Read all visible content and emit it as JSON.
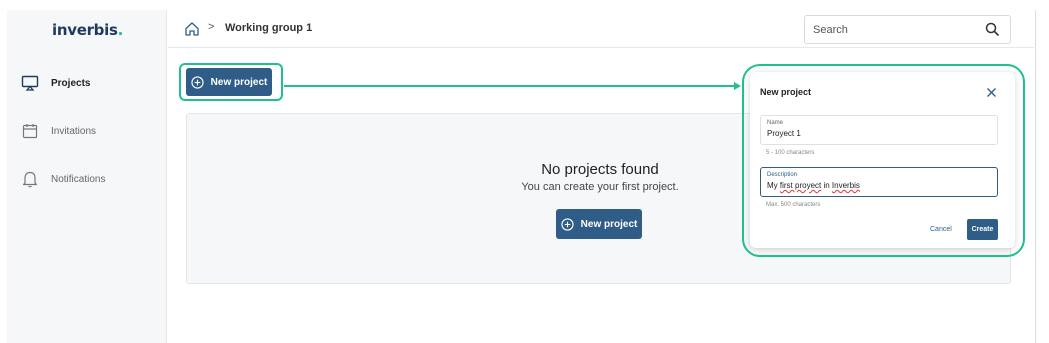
{
  "app": {
    "logo_text": "inverbis",
    "logo_dot": ".",
    "brand_color": "#1f3a5f",
    "accent_color": "#2cb78a"
  },
  "sidebar": {
    "items": [
      {
        "label": "Projects",
        "icon": "monitor-icon",
        "active": true
      },
      {
        "label": "Invitations",
        "icon": "calendar-icon",
        "active": false
      },
      {
        "label": "Notifications",
        "icon": "bell-icon",
        "active": false
      }
    ]
  },
  "header": {
    "breadcrumb_separator": ">",
    "title": "Working group 1",
    "home_icon": "home-icon"
  },
  "search": {
    "placeholder": "Search",
    "icon": "search-icon"
  },
  "main": {
    "new_project_label": "New project",
    "empty_title": "No projects found",
    "empty_subtitle": "You can create your first project.",
    "primary_color": "#2f5d88",
    "highlight_color": "#21bf8d"
  },
  "modal": {
    "title": "New project",
    "name_label": "Name",
    "name_value": "Proyect 1",
    "name_help": "5 - 100 characters",
    "description_label": "Description",
    "description_value_parts": [
      "My ",
      "first proyect",
      " in ",
      "Inverbis"
    ],
    "description_help": "Max. 500 characters",
    "cancel_label": "Cancel",
    "create_label": "Create"
  }
}
